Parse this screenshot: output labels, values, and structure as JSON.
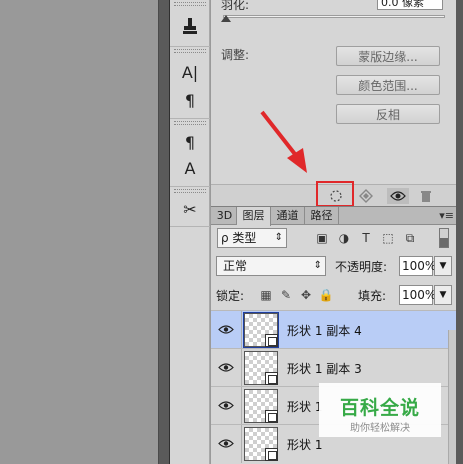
{
  "tools": {
    "items": [
      {
        "name": "clone-stamp-tool",
        "glyph": "⊥"
      },
      {
        "name": "character-panel",
        "glyph": "A|"
      },
      {
        "name": "paragraph-panel",
        "glyph": "¶"
      },
      {
        "name": "paragraph-styles",
        "glyph": "¶"
      },
      {
        "name": "character-styles",
        "glyph": "A"
      },
      {
        "name": "tool-presets",
        "glyph": "✂"
      }
    ]
  },
  "properties": {
    "feather_label": "羽化:",
    "feather_value": "0.0 像素",
    "adjust_label": "调整:",
    "buttons": {
      "mask_edge": "蒙版边缘...",
      "color_range": "颜色范围...",
      "invert": "反相"
    }
  },
  "properties_bottom": {
    "load_selection_icon": "⁙",
    "apply_mask_icon": "◈",
    "visibility_icon": "👁",
    "delete_icon": "🗑"
  },
  "layers_panel": {
    "tabs": [
      {
        "label": "3D"
      },
      {
        "label": "图层"
      },
      {
        "label": "通道"
      },
      {
        "label": "路径"
      }
    ],
    "filter": {
      "kind_label": "ρ 类型",
      "icons": [
        "▣",
        "◑",
        "T",
        "⬚",
        "⧉"
      ]
    },
    "blend_mode": "正常",
    "opacity_label": "不透明度:",
    "opacity_value": "100%",
    "lock_label": "锁定:",
    "lock_icons": [
      "▦",
      "✎",
      "✥",
      "🔒"
    ],
    "fill_label": "填充:",
    "fill_value": "100%",
    "layers": [
      {
        "name": "形状 1 副本 4",
        "selected": true
      },
      {
        "name": "形状 1 副本 3",
        "selected": false
      },
      {
        "name": "形状 1",
        "selected": false
      },
      {
        "name": "形状 1",
        "selected": false
      }
    ]
  },
  "watermark": {
    "title": "百科全说",
    "subtitle": "助你轻松解决"
  },
  "colors": {
    "highlight": "#e0282a",
    "selected_row": "#b9cdf6",
    "watermark_green": "#2fa840"
  }
}
